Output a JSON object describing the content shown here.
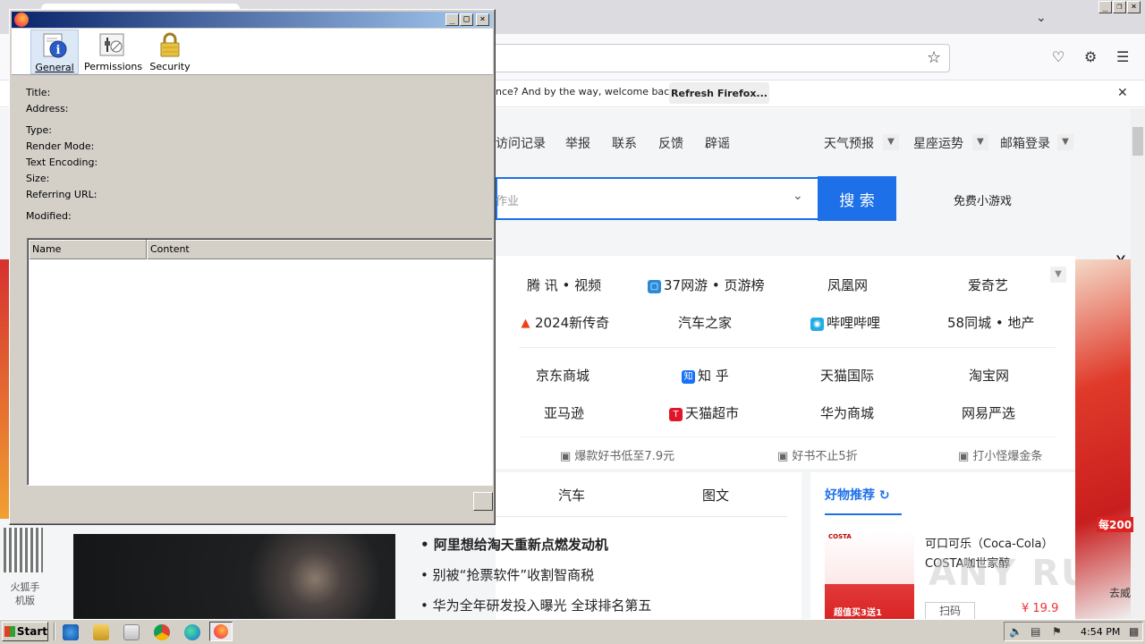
{
  "background_browser": {
    "notification": {
      "text": "nce? And by the way, welcome back!",
      "refresh_label": "Refresh Firefox..."
    },
    "top_nav": [
      "访问记录",
      "举报",
      "联系",
      "反馈",
      "辟谣"
    ],
    "top_nav_right": [
      "天气预报",
      "星座运势",
      "邮箱登录"
    ],
    "search": {
      "placeholder": "作业",
      "button_label": "搜 索",
      "side_link": "免费小游戏"
    },
    "close_label": "X",
    "sites": {
      "row1": [
        "腾 讯 • 视频",
        "37网游 • 页游榜",
        "凤凰网",
        "爱奇艺"
      ],
      "row2": [
        "2024新传奇",
        "汽车之家",
        "哔哩哔哩",
        "58同城 • 地产"
      ],
      "row3": [
        "京东商城",
        "知 乎",
        "天猫国际",
        "淘宝网"
      ],
      "row4": [
        "亚马逊",
        "天猫超市",
        "华为商城",
        "网易严选"
      ],
      "icons": {
        "r1": "cube-icon",
        "r2a": "flame-icon",
        "r2b": "bilibili-icon",
        "zhihu": "zhihu-icon",
        "tmall": "tmall-icon"
      }
    },
    "promos": [
      "爆款好书低至7.9元",
      "好书不止5折",
      "打小怪爆金条"
    ],
    "news_tabs": [
      "汽车",
      "图文"
    ],
    "news_items": [
      "阿里想给淘天重新点燃发动机",
      "别被“抢票软件”收割智商税",
      "华为全年研发投入曝光 全球排名第五"
    ],
    "recommend": {
      "title": "好物推荐",
      "product_name": "可口可乐（Coca-Cola）COSTA咖世家醇",
      "scan_label": "扫码",
      "price": "¥ 19.9",
      "image_brand": "COSTA",
      "image_deal": "超值买3送1"
    },
    "watermark": "ANY RUN",
    "left_sidebar_label": "火狐手机版",
    "right_ad_badge": "每200",
    "right_ad_label": "去威"
  },
  "dialog": {
    "tabs": [
      {
        "label": "General",
        "icon": "info-icon",
        "active": true
      },
      {
        "label": "Permissions",
        "icon": "permissions-icon",
        "active": false
      },
      {
        "label": "Security",
        "icon": "lock-icon",
        "active": false
      }
    ],
    "fields": {
      "title": "Title:",
      "address": "Address:",
      "type": "Type:",
      "render_mode": "Render Mode:",
      "text_encoding": "Text Encoding:",
      "size": "Size:",
      "referring_url": "Referring URL:",
      "modified": "Modified:"
    },
    "meta_table": {
      "columns": [
        "Name",
        "Content"
      ],
      "rows": []
    },
    "window_buttons": [
      "_",
      "□",
      "×"
    ]
  },
  "taskbar": {
    "start_label": "Start",
    "clock": "4:54 PM"
  },
  "outer_window_buttons": [
    "_",
    "❐",
    "×"
  ]
}
